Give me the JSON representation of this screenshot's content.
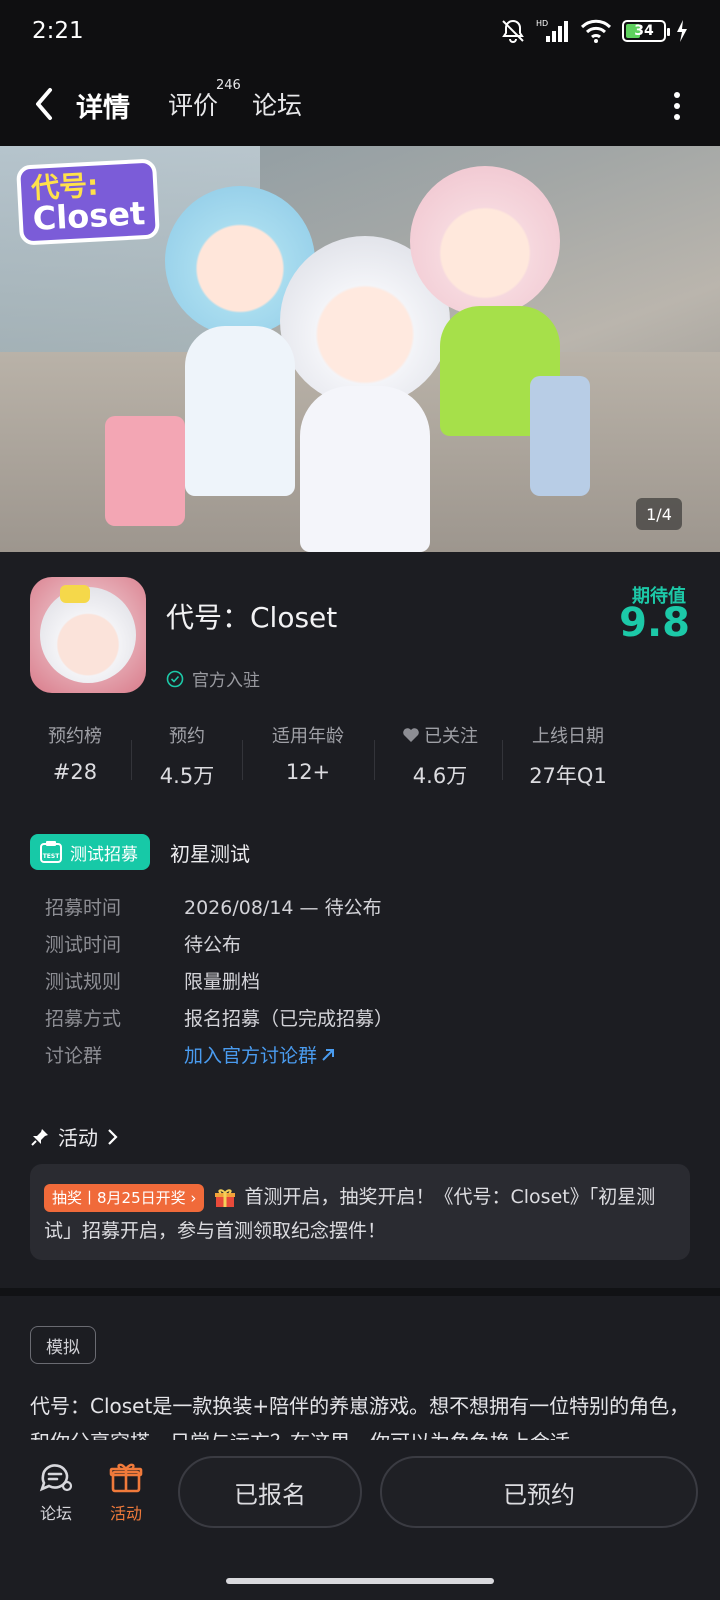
{
  "status": {
    "time": "2:21",
    "battery": "34",
    "network": "HD"
  },
  "nav": {
    "tab_detail": "详情",
    "tab_review": "评价",
    "review_count": "246",
    "tab_forum": "论坛"
  },
  "hero": {
    "logo_line1": "代号:",
    "logo_line2": "Closet",
    "counter": "1/4"
  },
  "app": {
    "title": "代号：Closet",
    "verified": "官方入驻",
    "score_label": "期待值",
    "score_value": "9.8"
  },
  "stats": [
    {
      "label": "预约榜",
      "value": "#28"
    },
    {
      "label": "预约",
      "value": "4.5万"
    },
    {
      "label": "适用年龄",
      "value": "12+"
    },
    {
      "label": "已关注",
      "value": "4.6万",
      "icon": "heart-icon"
    },
    {
      "label": "上线日期",
      "value": "27年Q1"
    }
  ],
  "recruit": {
    "badge": "测试招募",
    "badge_icon_text": "TEST",
    "title": "初星测试",
    "rows": [
      {
        "key": "招募时间",
        "value": "2026/08/14 — 待公布"
      },
      {
        "key": "测试时间",
        "value": "待公布"
      },
      {
        "key": "测试规则",
        "value": "限量删档"
      },
      {
        "key": "招募方式",
        "value": "报名招募（已完成招募）"
      },
      {
        "key": "讨论群",
        "value": "加入官方讨论群"
      }
    ]
  },
  "activity": {
    "header": "活动",
    "tag": "抽奖丨8月25日开奖",
    "text": "首测开启，抽奖开启！《代号：Closet》「初星测试」招募开启，参与首测领取纪念摆件！"
  },
  "genre_tag": "模拟",
  "description": "代号：Closet是一款换装+陪伴的养崽游戏。想不想拥有一位特别的角色，和你分享穿搭、日常与远方？在这里，你可以为角色换上合适",
  "bottom": {
    "forum": "论坛",
    "activity": "活动",
    "signed_up": "已报名",
    "reserved": "已预约"
  },
  "colors": {
    "accent": "#18c8a6",
    "orange": "#f07a3b",
    "link": "#4a9cf0",
    "background": "#1c1d22"
  }
}
